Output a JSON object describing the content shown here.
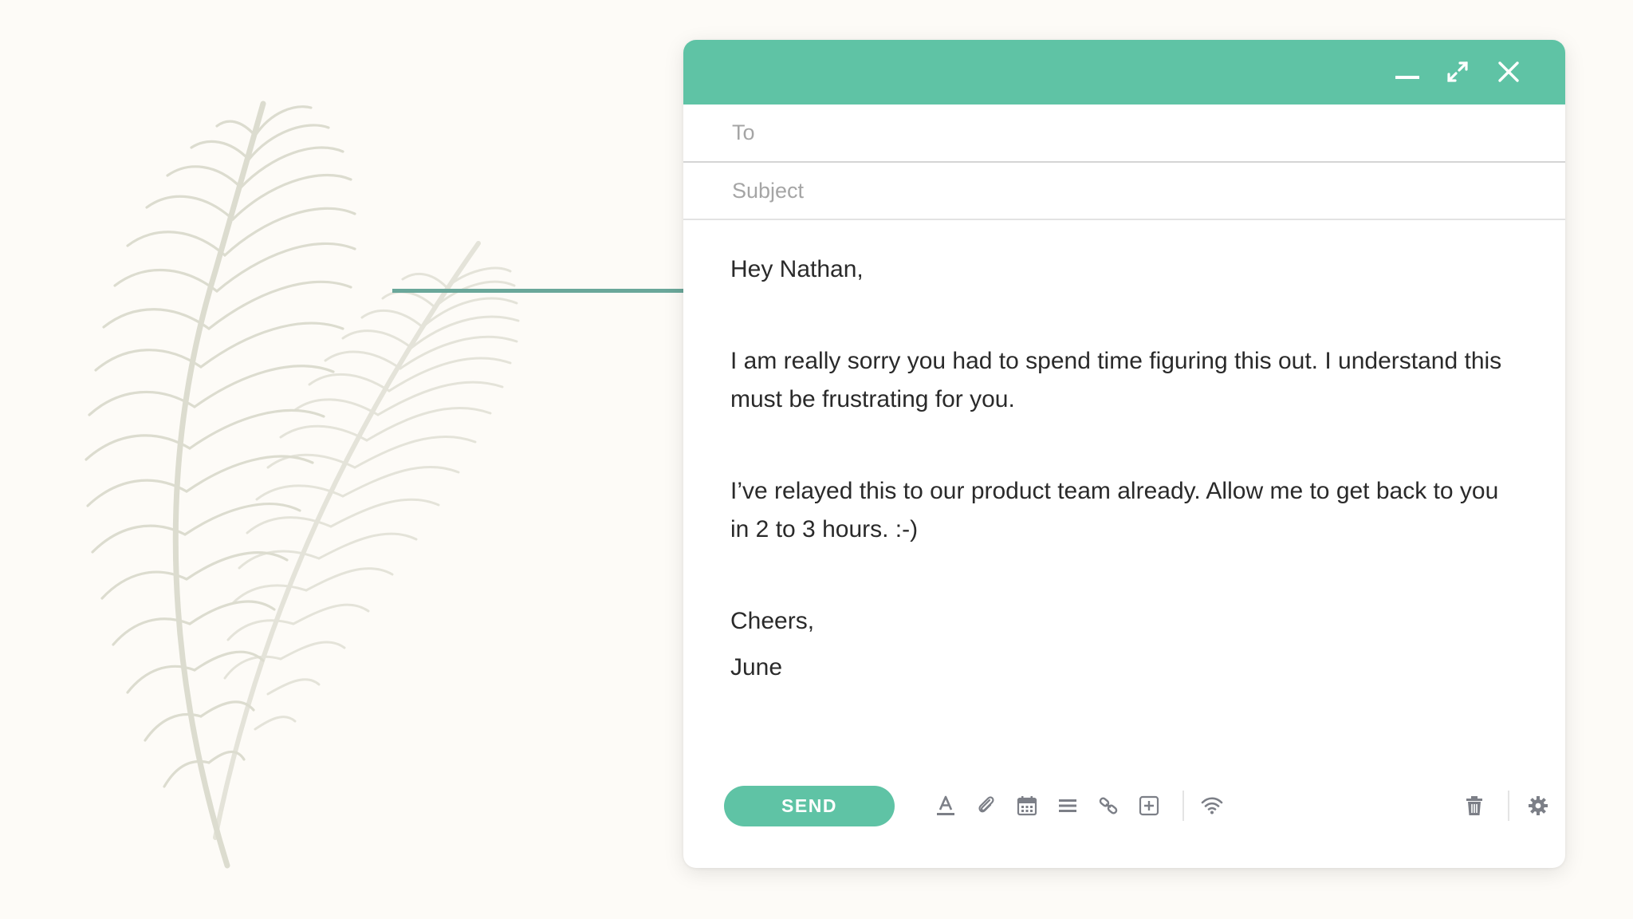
{
  "compose": {
    "window_controls": {
      "minimize_icon": "minimize-icon",
      "expand_icon": "expand-icon",
      "close_icon": "close-icon"
    },
    "to": {
      "placeholder": "To",
      "value": ""
    },
    "subject": {
      "placeholder": "Subject",
      "value": ""
    },
    "body": {
      "greeting": "Hey Nathan,",
      "paragraph1": "I am really sorry you had to spend time figuring this out. I understand this must be frustrating for you.",
      "paragraph2": "I’ve relayed this to our product team already. Allow me to get back to you in 2 to 3 hours. :-)",
      "signoff": "Cheers,",
      "name": "June"
    },
    "toolbar": {
      "send_label": "SEND",
      "icons": [
        "text-format-icon",
        "attach-icon",
        "calendar-icon",
        "list-icon",
        "link-icon",
        "insert-icon",
        "wifi-icon",
        "trash-icon",
        "gear-icon"
      ]
    }
  },
  "colors": {
    "accent": "#5fc3a5",
    "connector": "#6aa79a",
    "feather": "#dedfd2",
    "background": "#fdfbf7",
    "icon": "#7c7f87"
  }
}
